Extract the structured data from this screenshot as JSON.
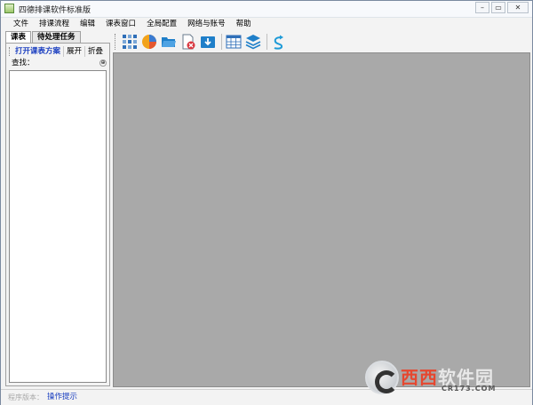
{
  "window": {
    "title": "四德排课软件标准版",
    "controls": {
      "minimize": "–",
      "restore": "▭",
      "close": "✕"
    }
  },
  "menu": [
    "文件",
    "排课流程",
    "编辑",
    "课表窗口",
    "全局配置",
    "网络与账号",
    "帮助"
  ],
  "left_panel": {
    "tabs": [
      {
        "label": "课表",
        "active": true
      },
      {
        "label": "待处理任务",
        "active": false
      }
    ],
    "toolbar": {
      "open_scheme": "打开课表方案",
      "expand": "展开",
      "collapse": "折叠"
    },
    "search": {
      "label": "查找：",
      "value": "",
      "button": "⊕"
    }
  },
  "toolbar_icons": [
    "schedule-grid-icon",
    "pie-chart-icon",
    "open-folder-icon",
    "close-document-icon",
    "download-folder-icon",
    "table-icon",
    "layers-icon",
    "export-arrow-icon"
  ],
  "statusbar": {
    "version_label": "程序版本：",
    "status": "操作提示"
  },
  "watermark": {
    "name_part1": "西西",
    "name_part2": "软件园",
    "url": "CR173.COM"
  },
  "colors": {
    "workspace": "#a9a9a9",
    "accent_blue": "#1a3ec0",
    "watermark_red": "#e6472f"
  }
}
